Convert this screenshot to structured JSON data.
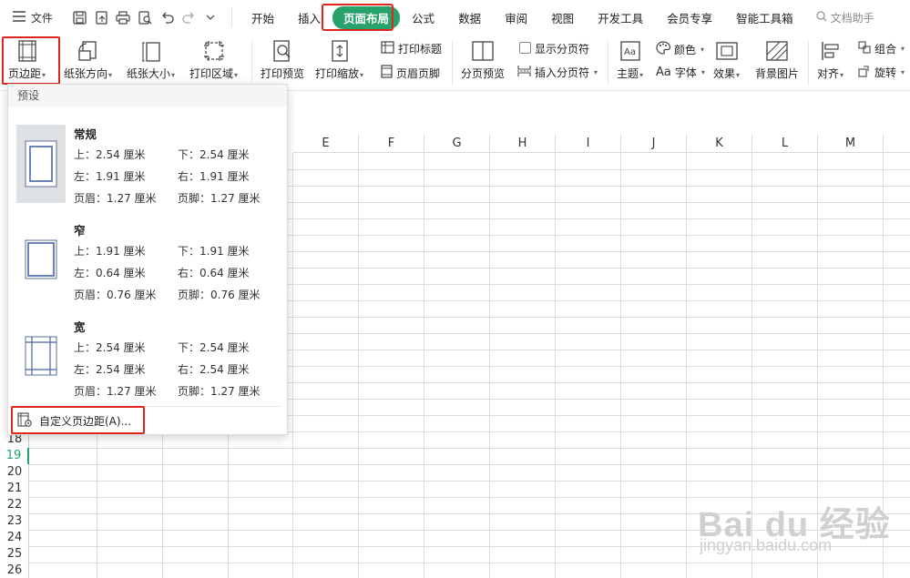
{
  "menubar": {
    "file_label": "文件",
    "tabs": [
      "开始",
      "插入",
      "页面布局",
      "公式",
      "数据",
      "审阅",
      "视图",
      "开发工具",
      "会员专享",
      "智能工具箱"
    ],
    "active_tab": "页面布局",
    "search_label": "文档助手",
    "accent_color": "#27a26a",
    "highlight_color": "#e0261c"
  },
  "ribbon": {
    "margins": "页边距",
    "orientation": "纸张方向",
    "size": "纸张大小",
    "print_area": "打印区域",
    "print_preview": "打印预览",
    "print_scale": "打印缩放",
    "print_titles": "打印标题",
    "header_footer": "页眉页脚",
    "page_break_preview": "分页预览",
    "show_page_breaks": "显示分页符",
    "insert_page_break": "插入分页符",
    "theme": "主题",
    "colors": "颜色",
    "fonts": "字体",
    "effects": "效果",
    "background": "背景图片",
    "align": "对齐",
    "group": "组合",
    "rotate": "旋转"
  },
  "sheet": {
    "columns": [
      "E",
      "F",
      "G",
      "H",
      "I",
      "J",
      "K",
      "L",
      "M"
    ],
    "rows": [
      "18",
      "19",
      "20",
      "21",
      "22",
      "23",
      "24",
      "25",
      "26"
    ],
    "selected_row": "19"
  },
  "margins_panel": {
    "title": "预设",
    "presets": [
      {
        "name": "常规",
        "top": "上：2.54 厘米",
        "bottom": "下：2.54 厘米",
        "left": "左：1.91 厘米",
        "right": "右：1.91 厘米",
        "header": "页眉：1.27 厘米",
        "footer": "页脚：1.27 厘米"
      },
      {
        "name": "窄",
        "top": "上：1.91 厘米",
        "bottom": "下：1.91 厘米",
        "left": "左：0.64 厘米",
        "right": "右：0.64 厘米",
        "header": "页眉：0.76 厘米",
        "footer": "页脚：0.76 厘米"
      },
      {
        "name": "宽",
        "top": "上：2.54 厘米",
        "bottom": "下：2.54 厘米",
        "left": "左：2.54 厘米",
        "right": "右：2.54 厘米",
        "header": "页眉：1.27 厘米",
        "footer": "页脚：1.27 厘米"
      }
    ],
    "custom_label": "自定义页边距(A)..."
  },
  "watermark": {
    "big": "Bai du 经验",
    "small": "jingyan.baidu.com"
  }
}
